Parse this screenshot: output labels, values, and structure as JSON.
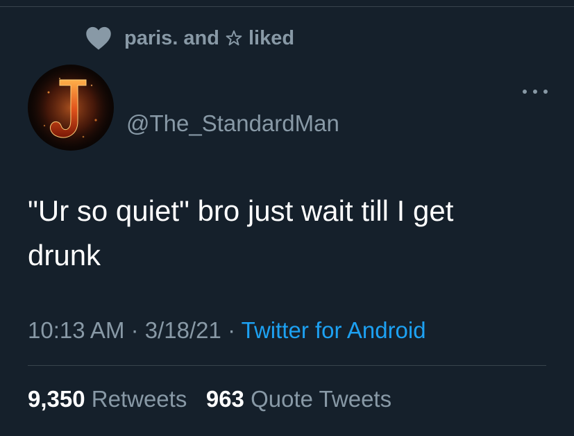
{
  "social_context": {
    "text_before": "paris. and",
    "text_after": "liked"
  },
  "author": {
    "handle": "@The_StandardMan",
    "avatar_letter": "J"
  },
  "tweet": {
    "text": "\"Ur so quiet\" bro just wait till I get\ndrunk",
    "time": "10:13 AM",
    "date": "3/18/21",
    "separator": "·",
    "source": "Twitter for Android"
  },
  "stats": {
    "retweets_count": "9,350",
    "retweets_label": "Retweets",
    "quotes_count": "963",
    "quotes_label": "Quote Tweets"
  },
  "colors": {
    "background": "#15202b",
    "secondary_text": "#8899a6",
    "link": "#1da1f2",
    "divider": "#38444d"
  }
}
